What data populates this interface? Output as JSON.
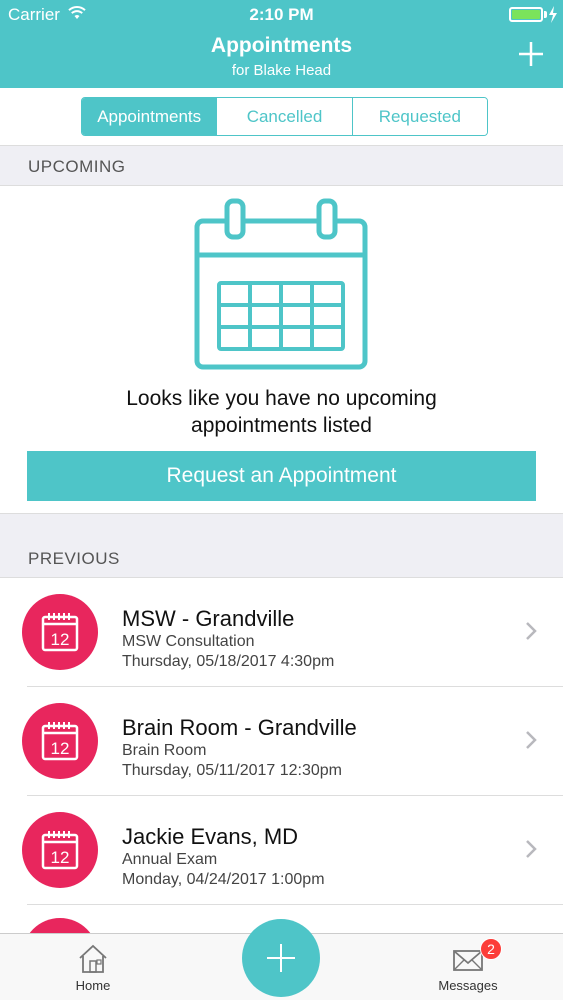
{
  "status_bar": {
    "carrier": "Carrier",
    "time": "2:10 PM",
    "battery_color": "#7be35b"
  },
  "nav": {
    "title": "Appointments",
    "subtitle": "for Blake Head",
    "add_icon": "plus-icon"
  },
  "segments": {
    "items": [
      {
        "label": "Appointments",
        "active": true
      },
      {
        "label": "Cancelled",
        "active": false
      },
      {
        "label": "Requested",
        "active": false
      }
    ]
  },
  "upcoming": {
    "header": "UPCOMING",
    "empty_icon": "calendar-icon",
    "empty_message": "Looks like you have no upcoming appointments listed",
    "request_button": "Request an Appointment"
  },
  "previous": {
    "header": "PREVIOUS",
    "items": [
      {
        "title": "MSW - Grandville",
        "subtitle": "MSW Consultation",
        "date": "Thursday, 05/18/2017 4:30pm",
        "icon_day": "12"
      },
      {
        "title": "Brain Room - Grandville",
        "subtitle": "Brain Room",
        "date": "Thursday, 05/11/2017 12:30pm",
        "icon_day": "12"
      },
      {
        "title": "Jackie Evans, MD",
        "subtitle": "Annual Exam",
        "date": "Monday, 04/24/2017 1:00pm",
        "icon_day": "12"
      }
    ]
  },
  "tabbar": {
    "home_label": "Home",
    "messages_label": "Messages",
    "messages_badge": "2"
  },
  "colors": {
    "accent": "#4ec5c8",
    "appointment_icon": "#e8265d",
    "badge": "#fc3d39"
  }
}
